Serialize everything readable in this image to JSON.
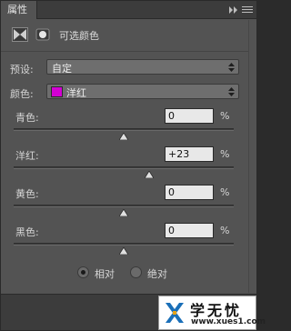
{
  "tab": {
    "label": "属性"
  },
  "header": {
    "title": "可选颜色"
  },
  "preset": {
    "label": "预设:",
    "value": "自定"
  },
  "colors": {
    "label": "颜色:",
    "value": "洋红",
    "swatch": "#d400d4"
  },
  "sliders": [
    {
      "label": "青色:",
      "value": "0",
      "unit": "%",
      "level": 0
    },
    {
      "label": "洋红:",
      "value": "+23",
      "unit": "%",
      "level": 23
    },
    {
      "label": "黄色:",
      "value": "0",
      "unit": "%",
      "level": 0
    },
    {
      "label": "黑色:",
      "value": "0",
      "unit": "%",
      "level": 0
    }
  ],
  "method": {
    "options": [
      "相对",
      "绝对"
    ],
    "selected": "相对"
  },
  "watermark": {
    "name": "学无忧",
    "url": "www.xues1.com"
  }
}
